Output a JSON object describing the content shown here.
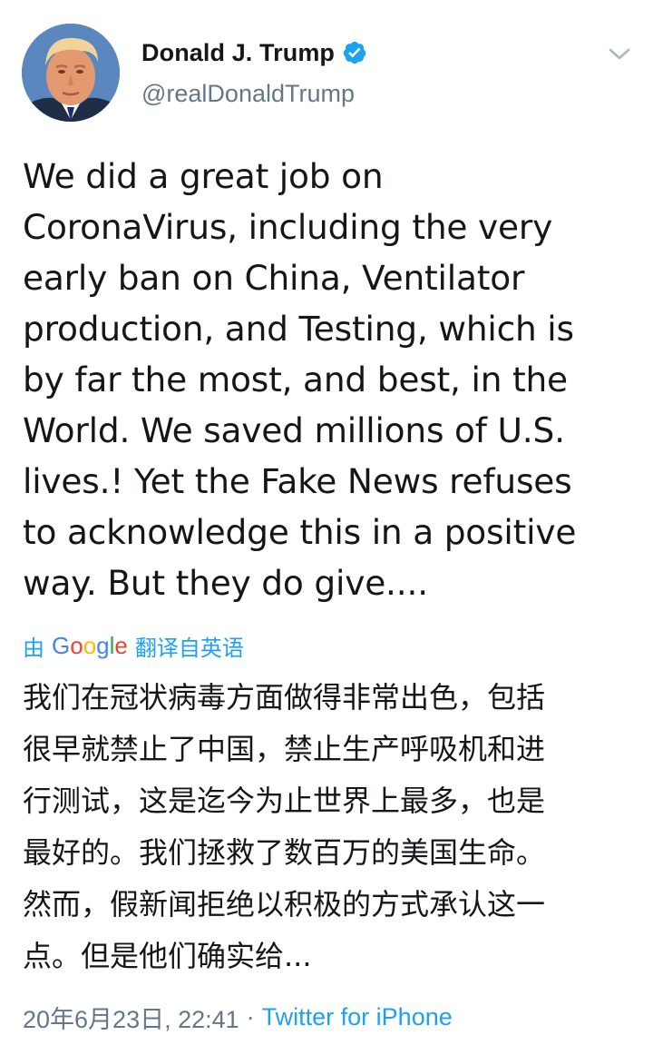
{
  "user": {
    "display_name": "Donald J. Trump",
    "handle": "@realDonaldTrump",
    "verified": true
  },
  "tweet": {
    "text": "We did a great job on\nCoronaVirus, including the very\nearly ban on China, Ventilator\nproduction, and Testing, which is\nby far the most, and best, in the\nWorld. We saved millions of U.S.\nlives.! Yet the Fake News refuses\nto acknowledge this in a positive\nway. But they do give....",
    "translation": {
      "by_label": "由",
      "provider": "Google",
      "from_label": "翻译自英语",
      "text": "我们在冠状病毒方面做得非常出色，包括\n很早就禁止了中国，禁止生产呼吸机和进\n行测试，这是迄今为止世界上最多，也是\n最好的。我们拯救了数百万的美国生命。\n然而，假新闻拒绝以积极的方式承认这一\n点。但是他们确实给..."
    },
    "timestamp": "20年6月23日, 22:41",
    "separator": "·",
    "source": "Twitter for iPhone"
  },
  "icons": {
    "verified": "verified-badge-icon",
    "menu": "chevron-down-icon"
  },
  "colors": {
    "accent": "#1da1f2",
    "text": "#14171a",
    "secondary": "#657786"
  }
}
